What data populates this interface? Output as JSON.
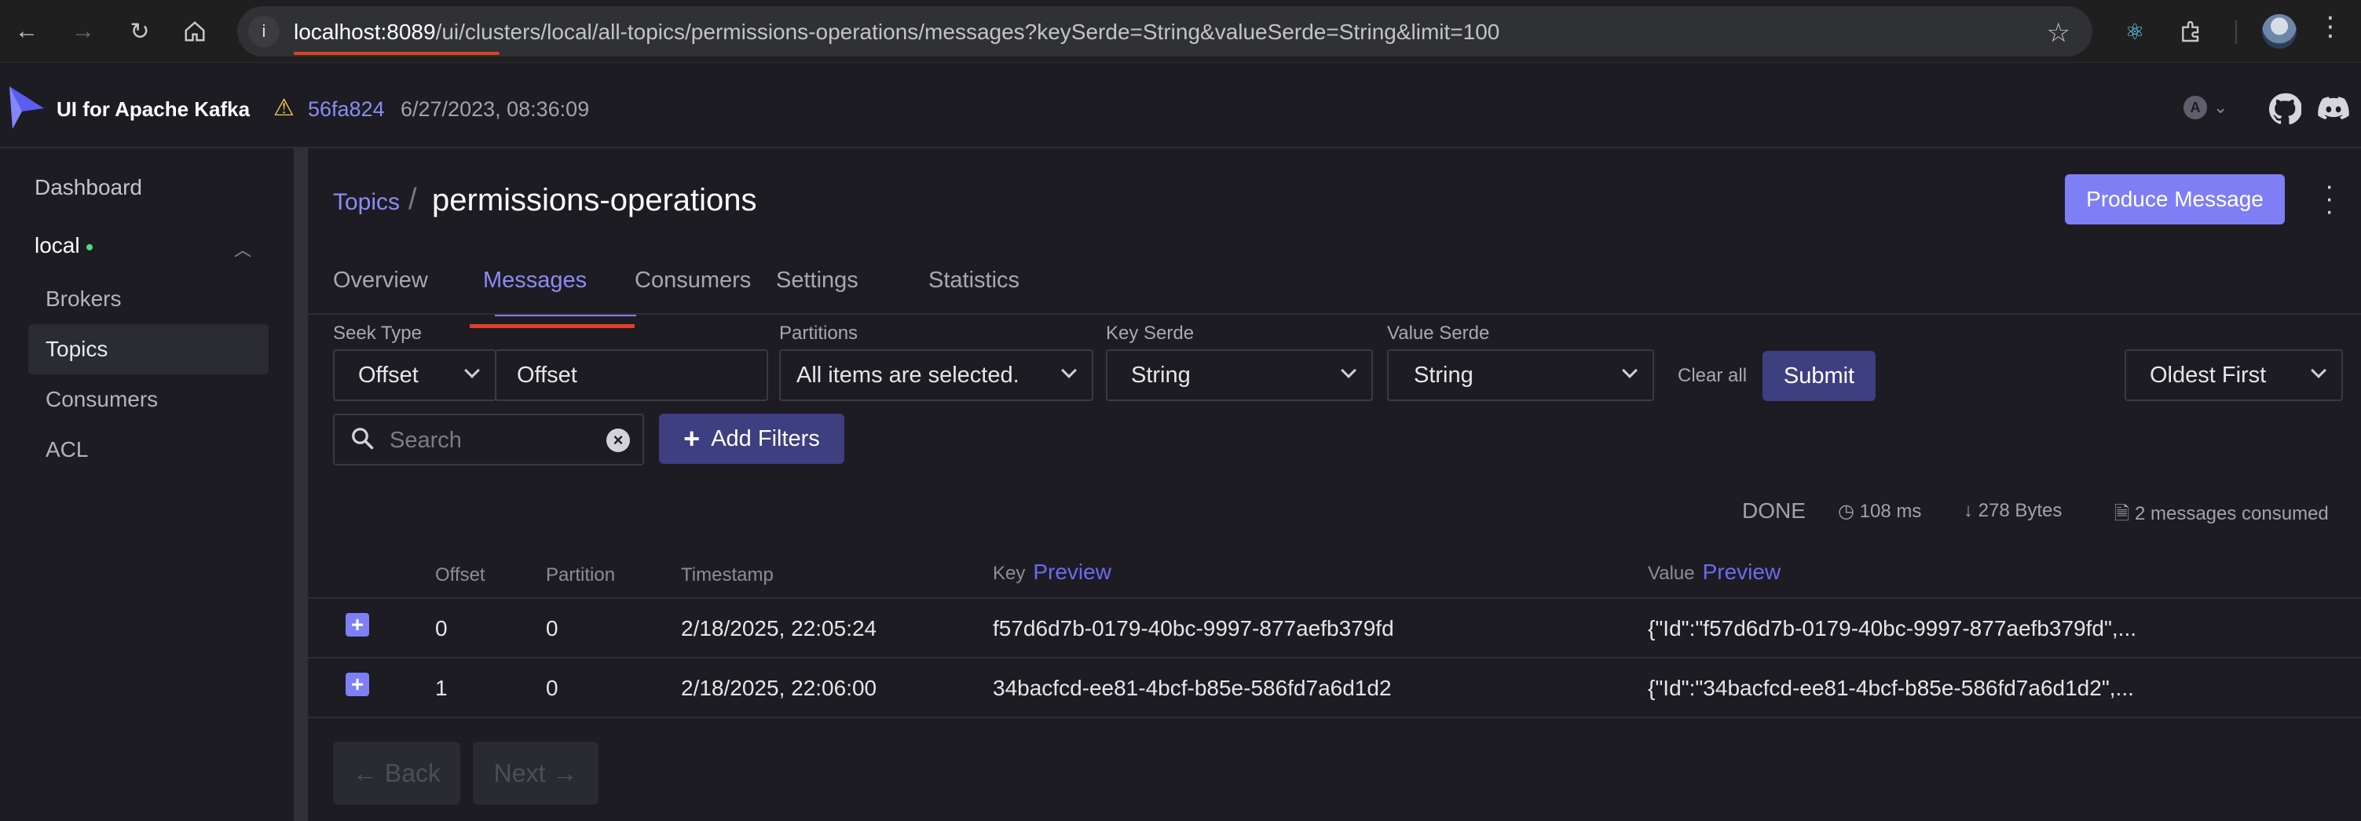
{
  "browser": {
    "url_host": "localhost:8089",
    "url_path": "/ui/clusters/local/all-topics/permissions-operations/messages?keySerde=String&valueSerde=String&limit=100",
    "icons": [
      "back-arrow-icon",
      "forward-arrow-icon",
      "reload-icon",
      "home-icon",
      "info-icon",
      "star-icon",
      "react-devtools-icon",
      "extensions-icon",
      "profile-avatar",
      "more-vert-icon"
    ]
  },
  "app": {
    "name": "UI for Apache Kafka",
    "version_hash": "56fa824",
    "version_date": "6/27/2023, 08:36:09",
    "theme_badge": "A",
    "colors": {
      "accent": "#7e7ff5",
      "link": "#8b8cf6",
      "background": "#1c1c22",
      "online": "#4ade80",
      "warning": "#f2c94c"
    }
  },
  "sidebar": {
    "dashboard": "Dashboard",
    "cluster": "local",
    "items": [
      {
        "label": "Brokers"
      },
      {
        "label": "Topics"
      },
      {
        "label": "Consumers"
      },
      {
        "label": "ACL"
      }
    ]
  },
  "header": {
    "breadcrumb_link": "Topics",
    "breadcrumb_sep": "/",
    "title": "permissions-operations",
    "produce_label": "Produce Message"
  },
  "tabs": [
    "Overview",
    "Messages",
    "Consumers",
    "Settings",
    "Statistics"
  ],
  "filters": {
    "seek_type_label": "Seek Type",
    "seek_type_value": "Offset",
    "seek_input_value": "Offset",
    "partitions_label": "Partitions",
    "partitions_value": "All items are selected.",
    "key_serde_label": "Key Serde",
    "key_serde_value": "String",
    "value_serde_label": "Value Serde",
    "value_serde_value": "String",
    "clear_all": "Clear all",
    "submit": "Submit",
    "sort_value": "Oldest First",
    "search_placeholder": "Search",
    "add_filters": "Add Filters"
  },
  "status": {
    "state": "DONE",
    "elapsed": "108 ms",
    "bytes": "278 Bytes",
    "consumed": "2 messages consumed"
  },
  "table": {
    "headers": {
      "offset": "Offset",
      "partition": "Partition",
      "timestamp": "Timestamp",
      "key": "Key",
      "value": "Value",
      "preview": "Preview"
    },
    "rows": [
      {
        "offset": "0",
        "partition": "0",
        "timestamp": "2/18/2025, 22:05:24",
        "key": "f57d6d7b-0179-40bc-9997-877aefb379fd",
        "value": "{\"Id\":\"f57d6d7b-0179-40bc-9997-877aefb379fd\",..."
      },
      {
        "offset": "1",
        "partition": "0",
        "timestamp": "2/18/2025, 22:06:00",
        "key": "34bacfcd-ee81-4bcf-b85e-586fd7a6d1d2",
        "value": "{\"Id\":\"34bacfcd-ee81-4bcf-b85e-586fd7a6d1d2\",..."
      }
    ]
  },
  "pager": {
    "back": "← Back",
    "next": "Next →"
  }
}
